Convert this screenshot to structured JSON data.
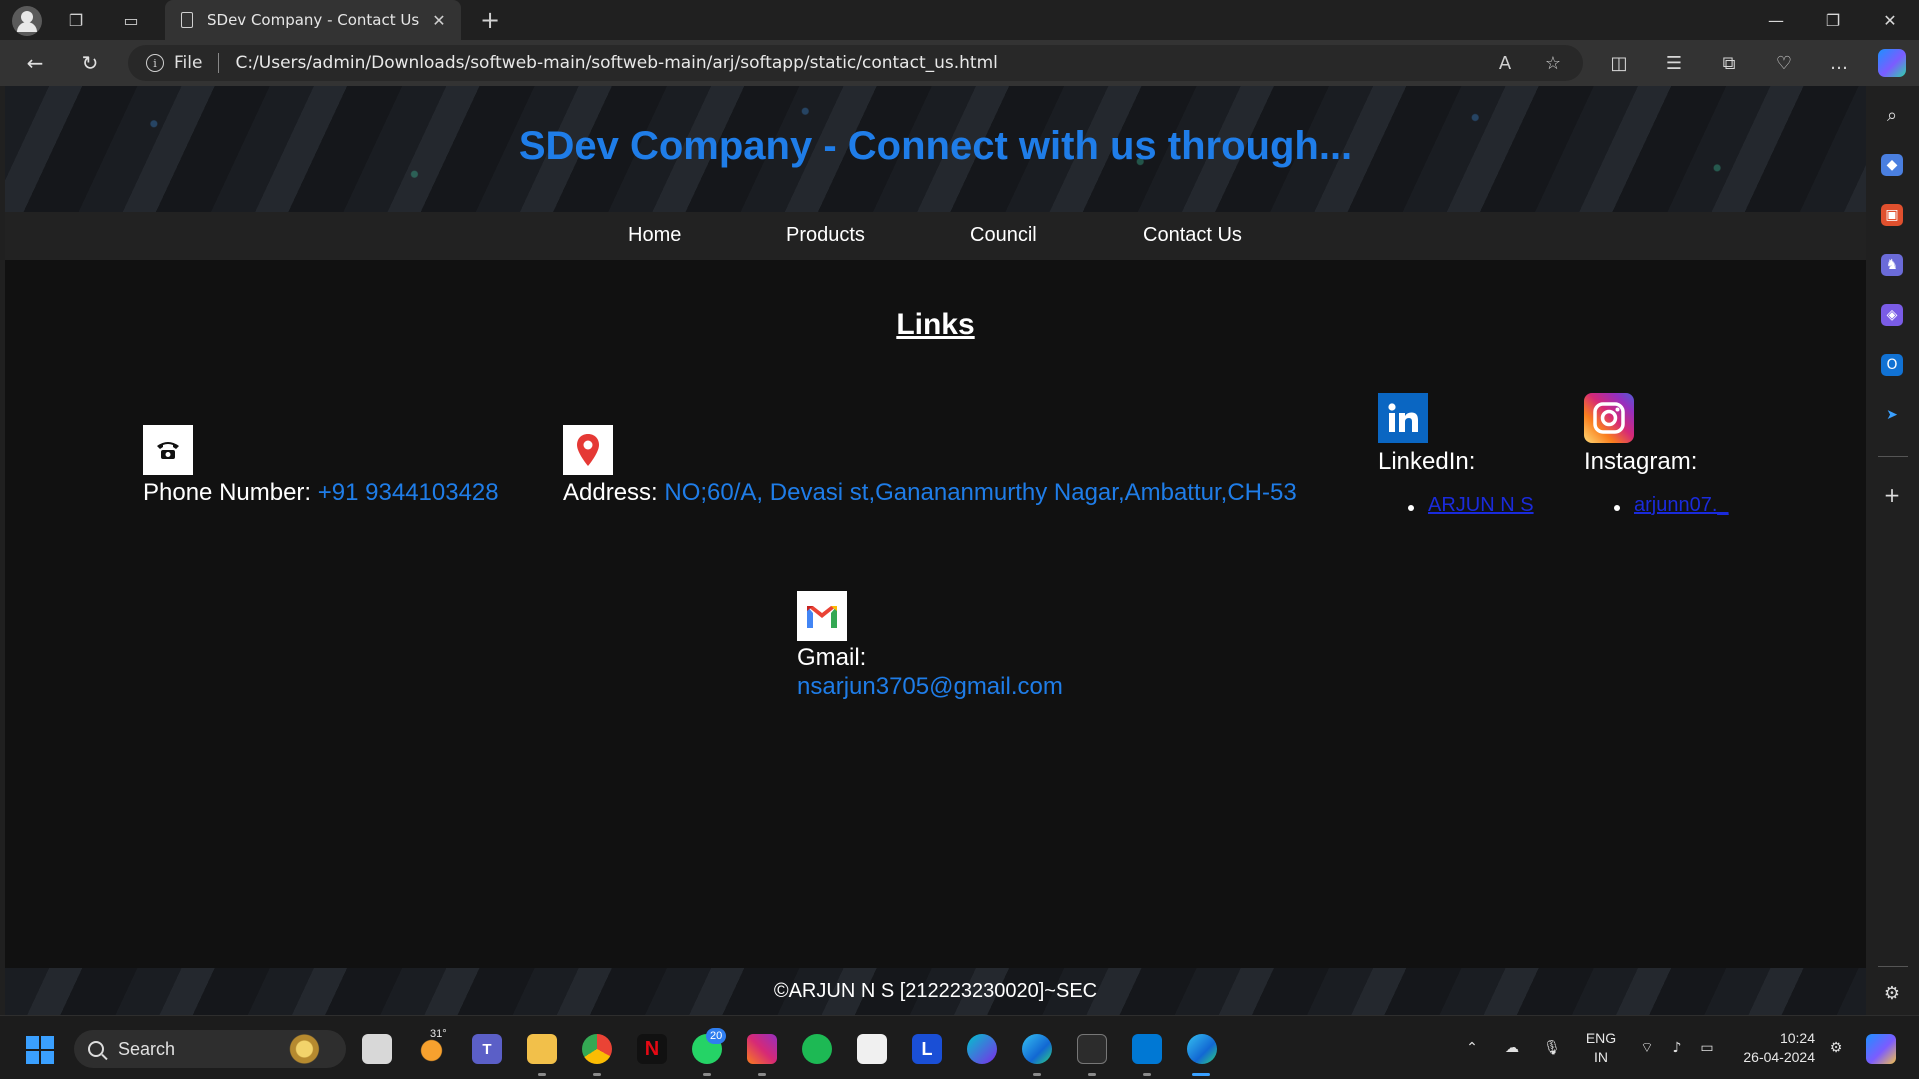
{
  "browser": {
    "tab_title": "SDev Company - Contact Us",
    "tab_close": "✕",
    "new_tab": "+",
    "file_label": "File",
    "url": "C:/Users/admin/Downloads/softweb-main/softweb-main/arj/softapp/static/contact_us.html"
  },
  "page": {
    "hero_title": "SDev Company - Connect with us through...",
    "nav": [
      "Home",
      "Products",
      "Council",
      "Contact Us"
    ],
    "links_heading": "Links",
    "phone": {
      "label": "Phone Number: ",
      "value": "+91 9344103428"
    },
    "address": {
      "label": "Address: ",
      "value": "NO;60/A, Devasi st,Ganananmurthy Nagar,Ambattur,CH-53"
    },
    "linkedin": {
      "label": "LinkedIn:",
      "link_text": "ARJUN N S"
    },
    "instagram": {
      "label": "Instagram:",
      "link_text": "arjunn07._"
    },
    "gmail": {
      "label": "Gmail:",
      "value": "nsarjun3705@gmail.com"
    },
    "footer": "©ARJUN N S [212223230020]~SEC"
  },
  "taskbar": {
    "search_label": "Search",
    "weather_temp": "31°",
    "whatsapp_badge": "20",
    "lang_line1": "ENG",
    "lang_line2": "IN",
    "time": "10:24",
    "date": "26-04-2024"
  },
  "colors": {
    "accent_blue": "#1f7de8",
    "link_blue": "#1a2bdc",
    "page_bg": "#111111"
  }
}
